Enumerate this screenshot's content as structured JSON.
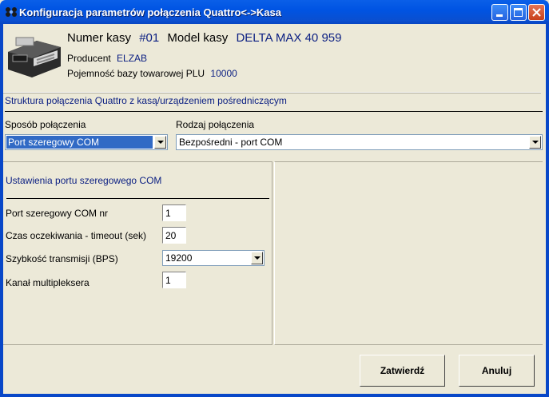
{
  "window": {
    "title": "Konfiguracja parametrów połączenia Quattro<->Kasa"
  },
  "device": {
    "register_label": "Numer kasy",
    "register_number": "#01",
    "model_label": "Model kasy",
    "model_value": "DELTA MAX 40 959",
    "producer_label": "Producent",
    "producer_value": "ELZAB",
    "plu_label": "Pojemność bazy towarowej PLU",
    "plu_value": "10000"
  },
  "structure": {
    "heading": "Struktura połączenia Quattro z kasą/urządzeniem pośredniczącym"
  },
  "connection": {
    "method_label": "Sposób połączenia",
    "method_value": "Port szeregowy COM",
    "type_label": "Rodzaj połączenia",
    "type_value": "Bezpośredni - port COM"
  },
  "com_settings": {
    "heading": "Ustawienia portu szeregowego COM",
    "port_label": "Port szeregowy COM nr",
    "port_value": "1",
    "timeout_label": "Czas oczekiwania - timeout (sek)",
    "timeout_value": "20",
    "speed_label": "Szybkość transmisji (BPS)",
    "speed_value": "19200",
    "mux_label": "Kanał multipleksera",
    "mux_value": "1"
  },
  "buttons": {
    "confirm": "Zatwierdź",
    "cancel": "Anuluj"
  }
}
